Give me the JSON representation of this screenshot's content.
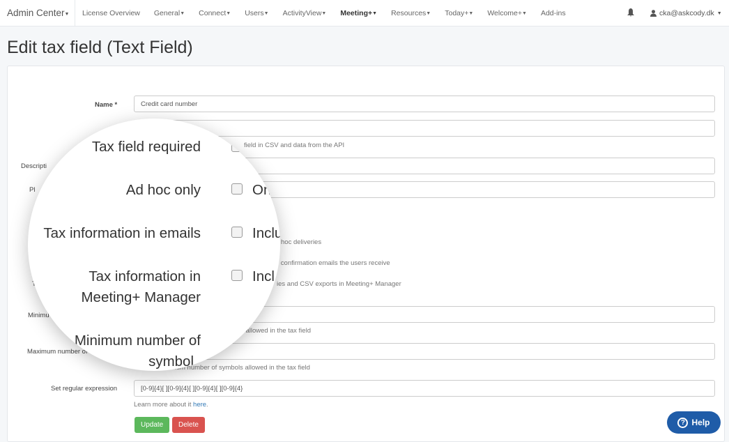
{
  "nav": {
    "brand": "Admin Center",
    "items": [
      {
        "label": "License Overview",
        "caret": false,
        "bold": false
      },
      {
        "label": "General",
        "caret": true,
        "bold": false
      },
      {
        "label": "Connect",
        "caret": true,
        "bold": false
      },
      {
        "label": "Users",
        "caret": true,
        "bold": false
      },
      {
        "label": "ActivityView",
        "caret": true,
        "bold": false
      },
      {
        "label": "Meeting+",
        "caret": true,
        "bold": true
      },
      {
        "label": "Resources",
        "caret": true,
        "bold": false
      },
      {
        "label": "Today+",
        "caret": true,
        "bold": false
      },
      {
        "label": "Welcome+",
        "caret": true,
        "bold": false
      },
      {
        "label": "Add-ins",
        "caret": false,
        "bold": false
      }
    ],
    "user": "cka@askcody.dk",
    "icons": {
      "bell": "bell-icon",
      "user": "user-icon"
    }
  },
  "page": {
    "title": "Edit tax field (Text Field)"
  },
  "form": {
    "name_label": "Name *",
    "name_value": "Credit card number",
    "description_label_fragment": "Descripti",
    "placeholder_label_fragment": "Pl",
    "minimum_label_fragment": "Minimu",
    "tax_label_fragment": "T",
    "maximum_label_fragment": "Maximum number of sy",
    "help_required_fragment": "field in CSV and data from the API",
    "help_adhoc_fragment": "hoc deliveries",
    "help_emails_fragment": "r confirmation emails the users receive",
    "help_manager_fragment": "ies and CSV exports in Meeting+ Manager",
    "help_min_fragment": "ls allowed in the tax field",
    "help_max": "Set the maximum number of symbols allowed in the tax field",
    "regex_label": "Set regular expression",
    "regex_value": "[0-9]{4}[ ][0-9]{4}[ ][0-9]{4}[ ][0-9]{4}",
    "learn_more": "Learn more about it ",
    "learn_more_link": "here",
    "learn_more_end": ".",
    "update": "Update",
    "delete": "Delete"
  },
  "lens": {
    "rows": [
      {
        "label": "Tax field required",
        "text": "",
        "checked": false
      },
      {
        "label": "Ad hoc only",
        "text": "On",
        "checked": false
      },
      {
        "label": "Tax information in emails",
        "text": "Inclu",
        "checked": false
      },
      {
        "label": "Tax information in",
        "label2": "Meeting+ Manager",
        "text": "Incl",
        "checked": false
      }
    ],
    "min_label": "Minimum number of",
    "min_label2": "symbol"
  },
  "help_button": "Help",
  "colors": {
    "update": "#5cb85c",
    "delete": "#d9534f",
    "help": "#1f5ca8",
    "link": "#337ab7"
  }
}
